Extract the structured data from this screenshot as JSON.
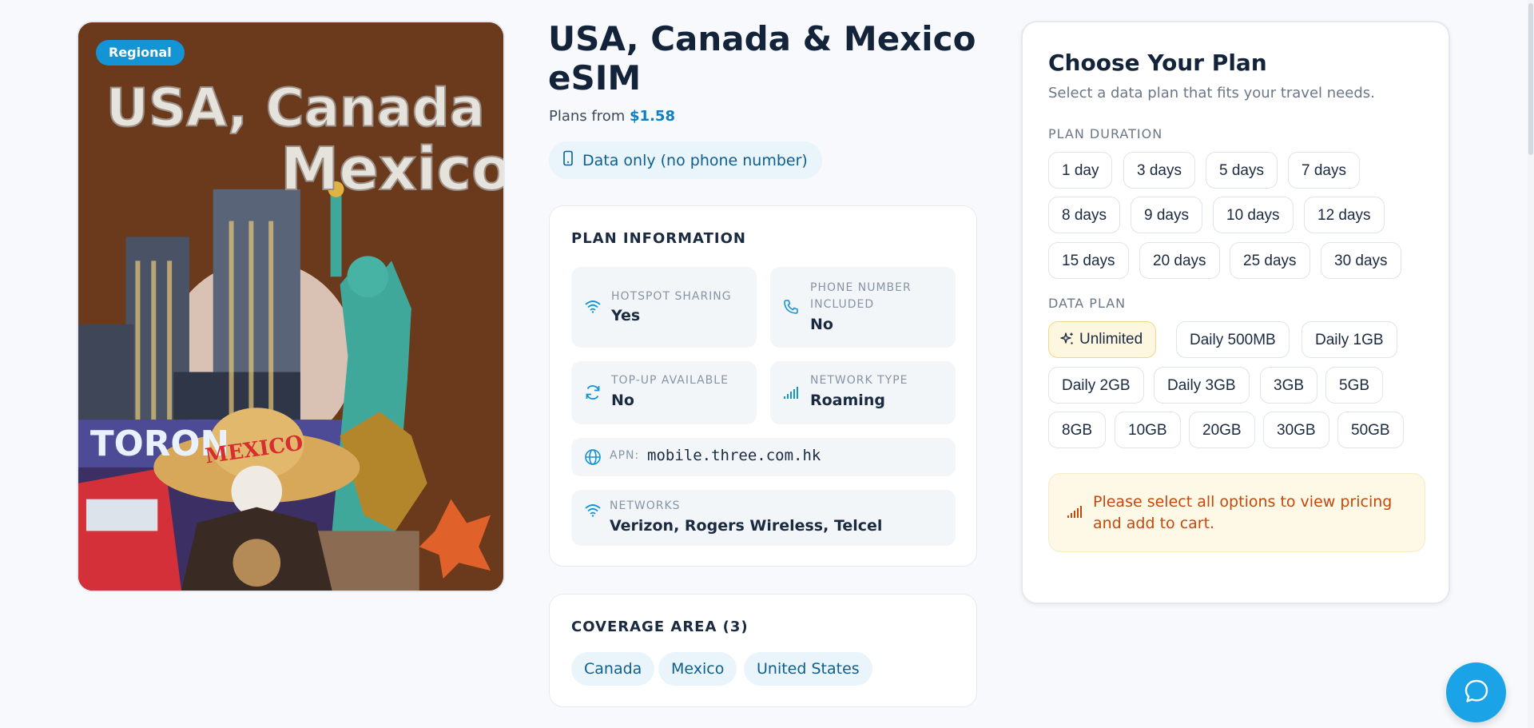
{
  "hero": {
    "badge": "Regional",
    "poster_line1": "USA, Canada",
    "poster_line2": "Mexico",
    "poster_toronto": "TORON",
    "poster_mexico": "MEXICO"
  },
  "product": {
    "title": "USA, Canada & Mexico eSIM",
    "plans_from_label": "Plans from",
    "plans_from_price": "$1.58",
    "data_only": "Data only (no phone number)"
  },
  "plan_info": {
    "heading": "PLAN INFORMATION",
    "hotspot": {
      "label": "HOTSPOT SHARING",
      "value": "Yes",
      "icon": "wifi-icon"
    },
    "phone": {
      "label": "PHONE NUMBER INCLUDED",
      "value": "No",
      "icon": "phone-icon"
    },
    "topup": {
      "label": "TOP-UP AVAILABLE",
      "value": "No",
      "icon": "refresh-icon"
    },
    "network_type": {
      "label": "NETWORK TYPE",
      "value": "Roaming",
      "icon": "signal-icon"
    },
    "apn": {
      "label": "APN:",
      "value": "mobile.three.com.hk",
      "icon": "globe-icon"
    },
    "networks": {
      "label": "NETWORKS",
      "value": "Verizon, Rogers Wireless, Telcel",
      "icon": "wifi-icon"
    }
  },
  "coverage": {
    "heading": "COVERAGE AREA (3)",
    "countries": [
      "Canada",
      "Mexico",
      "United States"
    ]
  },
  "plan_selector": {
    "title": "Choose Your Plan",
    "subtitle": "Select a data plan that fits your travel needs.",
    "duration_label": "PLAN DURATION",
    "durations": [
      "1 day",
      "3 days",
      "5 days",
      "7 days",
      "8 days",
      "9 days",
      "10 days",
      "12 days",
      "15 days",
      "20 days",
      "25 days",
      "30 days"
    ],
    "data_label": "DATA PLAN",
    "data_plans": [
      "Unlimited",
      "Daily 500MB",
      "Daily 1GB",
      "Daily 2GB",
      "Daily 3GB",
      "3GB",
      "5GB",
      "8GB",
      "10GB",
      "20GB",
      "30GB",
      "50GB"
    ],
    "selected_data_plan": "Unlimited",
    "notice": "Please select all options to view pricing and add to cart."
  },
  "colors": {
    "accent": "#1494d4",
    "price": "#0f7fc0",
    "notice_text": "#c4480c",
    "selected_bg": "#fef7df"
  }
}
